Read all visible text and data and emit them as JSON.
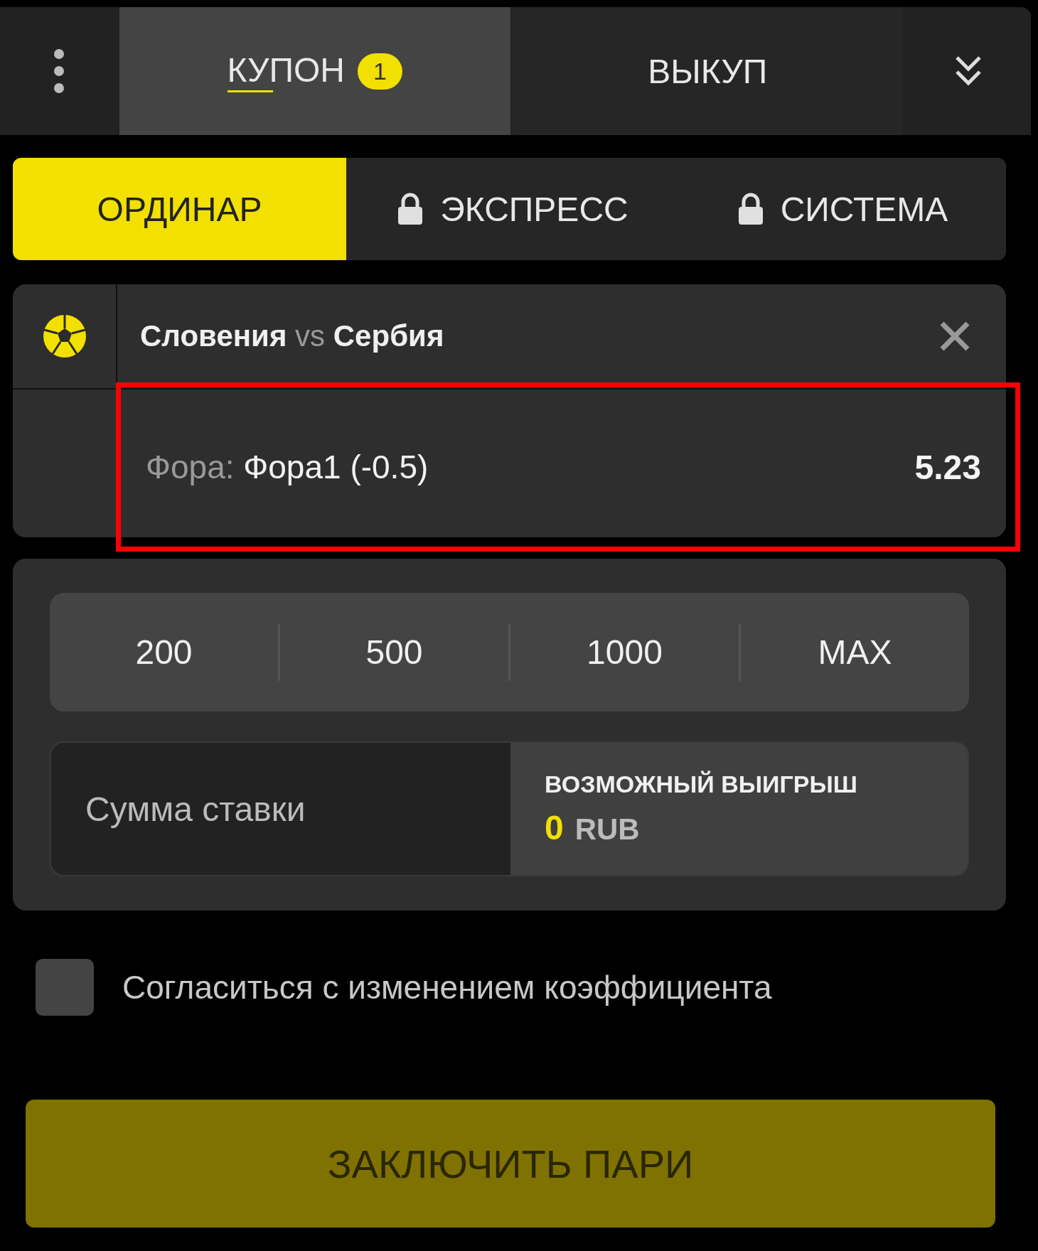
{
  "top_tabs": [
    {
      "label": "КУПОН",
      "badge": "1",
      "selected": true
    },
    {
      "label": "ВЫКУП",
      "selected": false
    }
  ],
  "mode_tabs": [
    {
      "label": "ОРДИНАР",
      "selected": true,
      "locked": false
    },
    {
      "label": "ЭКСПРЕСС",
      "selected": false,
      "locked": true
    },
    {
      "label": "СИСТЕМА",
      "selected": false,
      "locked": true
    }
  ],
  "event": {
    "home": "Словения",
    "vs": "vs",
    "away": "Сербия",
    "market": "Фора:",
    "outcome": "Фора1 (-0.5)",
    "odds": "5.23",
    "highlighted": true
  },
  "quick_amounts": [
    "200",
    "500",
    "1000",
    "MAX"
  ],
  "stake": {
    "placeholder": "Сумма ставки",
    "win_label": "ВОЗМОЖНЫЙ ВЫИГРЫШ",
    "win_amount": "0",
    "currency": "RUB"
  },
  "accept_changes": {
    "label": "Согласиться с изменением коэффициента",
    "checked": false
  },
  "submit": {
    "label": "ЗАКЛЮЧИТЬ ПАРИ",
    "disabled": true
  }
}
